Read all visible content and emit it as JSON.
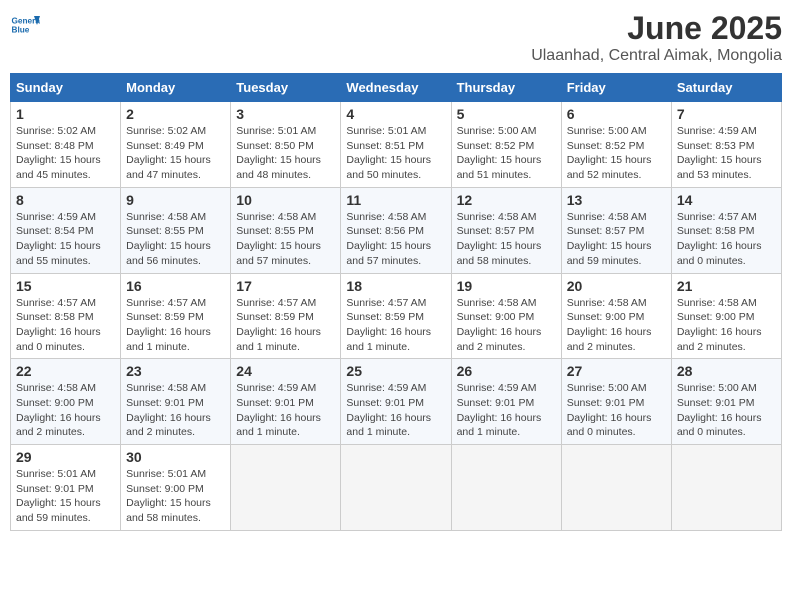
{
  "logo": {
    "line1": "General",
    "line2": "Blue"
  },
  "title": "June 2025",
  "subtitle": "Ulaanhad, Central Aimak, Mongolia",
  "weekdays": [
    "Sunday",
    "Monday",
    "Tuesday",
    "Wednesday",
    "Thursday",
    "Friday",
    "Saturday"
  ],
  "weeks": [
    [
      {
        "day": "1",
        "sunrise": "5:02 AM",
        "sunset": "8:48 PM",
        "daylight": "15 hours and 45 minutes."
      },
      {
        "day": "2",
        "sunrise": "5:02 AM",
        "sunset": "8:49 PM",
        "daylight": "15 hours and 47 minutes."
      },
      {
        "day": "3",
        "sunrise": "5:01 AM",
        "sunset": "8:50 PM",
        "daylight": "15 hours and 48 minutes."
      },
      {
        "day": "4",
        "sunrise": "5:01 AM",
        "sunset": "8:51 PM",
        "daylight": "15 hours and 50 minutes."
      },
      {
        "day": "5",
        "sunrise": "5:00 AM",
        "sunset": "8:52 PM",
        "daylight": "15 hours and 51 minutes."
      },
      {
        "day": "6",
        "sunrise": "5:00 AM",
        "sunset": "8:52 PM",
        "daylight": "15 hours and 52 minutes."
      },
      {
        "day": "7",
        "sunrise": "4:59 AM",
        "sunset": "8:53 PM",
        "daylight": "15 hours and 53 minutes."
      }
    ],
    [
      {
        "day": "8",
        "sunrise": "4:59 AM",
        "sunset": "8:54 PM",
        "daylight": "15 hours and 55 minutes."
      },
      {
        "day": "9",
        "sunrise": "4:58 AM",
        "sunset": "8:55 PM",
        "daylight": "15 hours and 56 minutes."
      },
      {
        "day": "10",
        "sunrise": "4:58 AM",
        "sunset": "8:55 PM",
        "daylight": "15 hours and 57 minutes."
      },
      {
        "day": "11",
        "sunrise": "4:58 AM",
        "sunset": "8:56 PM",
        "daylight": "15 hours and 57 minutes."
      },
      {
        "day": "12",
        "sunrise": "4:58 AM",
        "sunset": "8:57 PM",
        "daylight": "15 hours and 58 minutes."
      },
      {
        "day": "13",
        "sunrise": "4:58 AM",
        "sunset": "8:57 PM",
        "daylight": "15 hours and 59 minutes."
      },
      {
        "day": "14",
        "sunrise": "4:57 AM",
        "sunset": "8:58 PM",
        "daylight": "16 hours and 0 minutes."
      }
    ],
    [
      {
        "day": "15",
        "sunrise": "4:57 AM",
        "sunset": "8:58 PM",
        "daylight": "16 hours and 0 minutes."
      },
      {
        "day": "16",
        "sunrise": "4:57 AM",
        "sunset": "8:59 PM",
        "daylight": "16 hours and 1 minute."
      },
      {
        "day": "17",
        "sunrise": "4:57 AM",
        "sunset": "8:59 PM",
        "daylight": "16 hours and 1 minute."
      },
      {
        "day": "18",
        "sunrise": "4:57 AM",
        "sunset": "8:59 PM",
        "daylight": "16 hours and 1 minute."
      },
      {
        "day": "19",
        "sunrise": "4:58 AM",
        "sunset": "9:00 PM",
        "daylight": "16 hours and 2 minutes."
      },
      {
        "day": "20",
        "sunrise": "4:58 AM",
        "sunset": "9:00 PM",
        "daylight": "16 hours and 2 minutes."
      },
      {
        "day": "21",
        "sunrise": "4:58 AM",
        "sunset": "9:00 PM",
        "daylight": "16 hours and 2 minutes."
      }
    ],
    [
      {
        "day": "22",
        "sunrise": "4:58 AM",
        "sunset": "9:00 PM",
        "daylight": "16 hours and 2 minutes."
      },
      {
        "day": "23",
        "sunrise": "4:58 AM",
        "sunset": "9:01 PM",
        "daylight": "16 hours and 2 minutes."
      },
      {
        "day": "24",
        "sunrise": "4:59 AM",
        "sunset": "9:01 PM",
        "daylight": "16 hours and 1 minute."
      },
      {
        "day": "25",
        "sunrise": "4:59 AM",
        "sunset": "9:01 PM",
        "daylight": "16 hours and 1 minute."
      },
      {
        "day": "26",
        "sunrise": "4:59 AM",
        "sunset": "9:01 PM",
        "daylight": "16 hours and 1 minute."
      },
      {
        "day": "27",
        "sunrise": "5:00 AM",
        "sunset": "9:01 PM",
        "daylight": "16 hours and 0 minutes."
      },
      {
        "day": "28",
        "sunrise": "5:00 AM",
        "sunset": "9:01 PM",
        "daylight": "16 hours and 0 minutes."
      }
    ],
    [
      {
        "day": "29",
        "sunrise": "5:01 AM",
        "sunset": "9:01 PM",
        "daylight": "15 hours and 59 minutes."
      },
      {
        "day": "30",
        "sunrise": "5:01 AM",
        "sunset": "9:00 PM",
        "daylight": "15 hours and 58 minutes."
      },
      null,
      null,
      null,
      null,
      null
    ]
  ],
  "labels": {
    "sunrise": "Sunrise:",
    "sunset": "Sunset:",
    "daylight": "Daylight:"
  }
}
